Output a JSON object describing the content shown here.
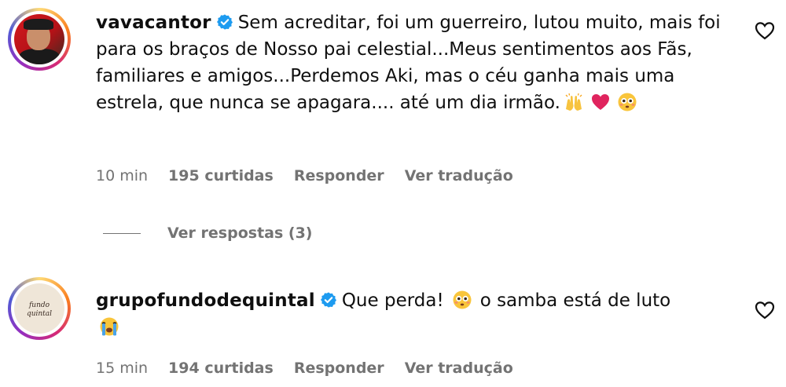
{
  "comments": [
    {
      "username": "vavacantor",
      "text_parts": [
        "Sem acreditar, foi um guerreiro, lutou muito, mais foi para os braços de Nosso pai celestial...Meus sentimentos aos Fãs, familiares e amigos...Perdemos Aki, mas o céu ganha mais uma estrela, que nunca se apagara.... até um dia irmão."
      ],
      "emojis": [
        "raising-hands-emoji",
        "red-heart-emoji",
        "flushed-face-emoji"
      ],
      "time": "10 min",
      "likes": "195 curtidas",
      "reply_label": "Responder",
      "translate_label": "Ver tradução",
      "view_replies": "Ver respostas (3)"
    },
    {
      "username": "grupofundodequintal",
      "text_before": "Que perda!",
      "text_after": "o samba está de luto",
      "emojis": [
        "flushed-face-emoji",
        "crying-face-emoji"
      ],
      "time": "15 min",
      "likes": "194 curtidas",
      "reply_label": "Responder",
      "translate_label": "Ver tradução",
      "avatar_logo_text": "fundo de quintal"
    }
  ],
  "colors": {
    "verified": "#1d9bf0",
    "meta_text": "#737373",
    "heart_emoji": "#e0245e"
  }
}
